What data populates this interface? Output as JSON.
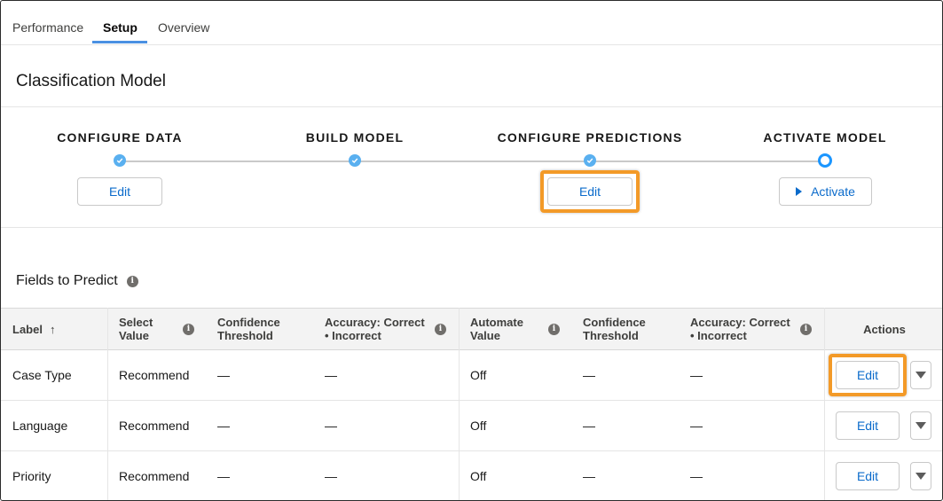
{
  "tabs": [
    {
      "label": "Performance",
      "active": false
    },
    {
      "label": "Setup",
      "active": true
    },
    {
      "label": "Overview",
      "active": false
    }
  ],
  "page_title": "Classification Model",
  "steps": [
    {
      "label": "CONFIGURE DATA",
      "state": "complete",
      "button": "Edit"
    },
    {
      "label": "BUILD MODEL",
      "state": "complete",
      "button": ""
    },
    {
      "label": "CONFIGURE PREDICTIONS",
      "state": "complete",
      "button": "Edit"
    },
    {
      "label": "ACTIVATE MODEL",
      "state": "current",
      "button": "Activate"
    }
  ],
  "fields_section": {
    "title": "Fields to Predict",
    "info_icon": "info-icon"
  },
  "table": {
    "columns": [
      "Label",
      "Select\nValue",
      "Confidence\nThreshold",
      "Accuracy: Correct\n• Incorrect",
      "Automate\nValue",
      "Confidence\nThreshold",
      "Accuracy: Correct\n• Incorrect",
      "Actions"
    ],
    "sort_icon": "↑",
    "rows": [
      {
        "label": "Case Type",
        "select_value": "Recommend",
        "conf1": "—",
        "acc1": "—",
        "automate": "Off",
        "conf2": "—",
        "acc2": "—",
        "action": "Edit"
      },
      {
        "label": "Language",
        "select_value": "Recommend",
        "conf1": "—",
        "acc1": "—",
        "automate": "Off",
        "conf2": "—",
        "acc2": "—",
        "action": "Edit"
      },
      {
        "label": "Priority",
        "select_value": "Recommend",
        "conf1": "—",
        "acc1": "—",
        "automate": "Off",
        "conf2": "—",
        "acc2": "—",
        "action": "Edit"
      }
    ]
  },
  "colors": {
    "accent": "#1b96ff",
    "link": "#0b6bcb",
    "highlight": "#f39a28",
    "tab_underline": "#4a90e2"
  }
}
